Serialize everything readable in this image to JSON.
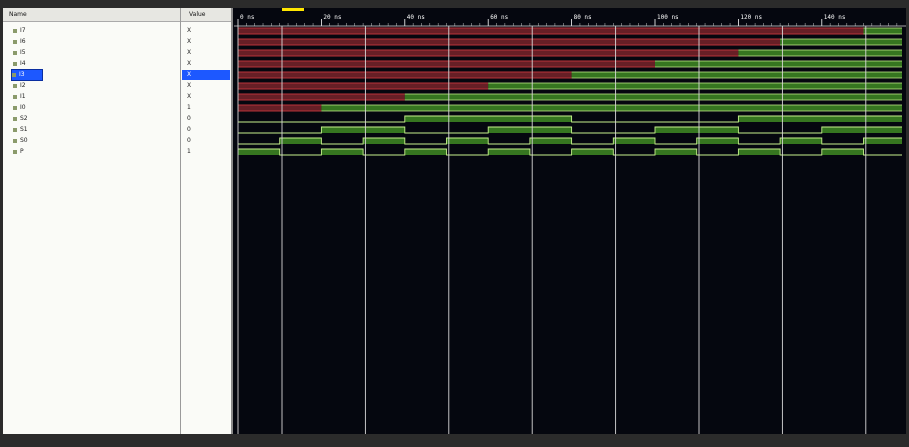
{
  "names_panel": {
    "header": "Name"
  },
  "values_panel": {
    "header": "Value"
  },
  "signals": [
    {
      "name": "I7",
      "value": "X",
      "kind": "bus"
    },
    {
      "name": "I6",
      "value": "X",
      "kind": "bus"
    },
    {
      "name": "I5",
      "value": "X",
      "kind": "bus"
    },
    {
      "name": "I4",
      "value": "X",
      "kind": "bus"
    },
    {
      "name": "I3",
      "value": "X",
      "kind": "bus",
      "selected": true
    },
    {
      "name": "I2",
      "value": "X",
      "kind": "bus"
    },
    {
      "name": "I1",
      "value": "X",
      "kind": "bus"
    },
    {
      "name": "I0",
      "value": "1",
      "kind": "bus"
    },
    {
      "name": "S2",
      "value": "0",
      "kind": "bit"
    },
    {
      "name": "S1",
      "value": "0",
      "kind": "bit"
    },
    {
      "name": "S0",
      "value": "0",
      "kind": "bit"
    },
    {
      "name": "P",
      "value": "1",
      "kind": "bit"
    }
  ],
  "timeline": {
    "unit": "ns",
    "tick_labels": [
      "0 ns",
      "20 ns",
      "40 ns",
      "60 ns",
      "80 ns",
      "100 ns",
      "120 ns",
      "140 ns"
    ],
    "tick_values": [
      0,
      20,
      40,
      60,
      80,
      100,
      120,
      140
    ]
  },
  "colors": {
    "undefined": "#b8333a",
    "defined": "#3f8a23",
    "signal_line": "#c6f08c",
    "cursor": "#ffe600",
    "selection": "#1d58ff"
  }
}
